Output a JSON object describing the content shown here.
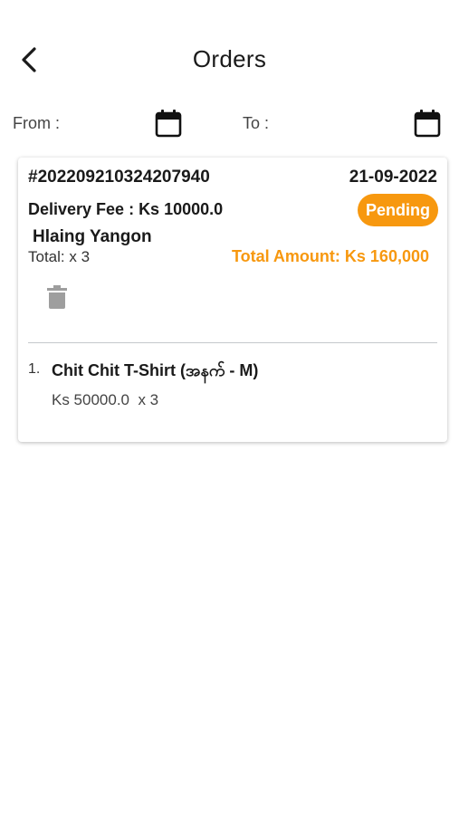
{
  "header": {
    "title": "Orders",
    "back_icon": "chevron-left-icon"
  },
  "filters": {
    "from_label": "From :",
    "to_label": "To :",
    "calendar_icon": "calendar-icon"
  },
  "order": {
    "id": "#202209210324207940",
    "date": "21-09-2022",
    "delivery_fee": "Delivery Fee : Ks 10000.0",
    "status": "Pending",
    "location": "Hlaing Yangon",
    "total_qty": "Total: x 3",
    "total_amount": "Total Amount: Ks 160,000",
    "delete_icon": "trash-icon",
    "items": [
      {
        "index": "1.",
        "name": "Chit Chit T-Shirt (အနက် - M)",
        "price": "Ks 50000.0  x 3"
      }
    ]
  },
  "colors": {
    "accent": "#f7980f",
    "text": "#1a1a1a",
    "icon_gray": "#9e9e9e"
  }
}
